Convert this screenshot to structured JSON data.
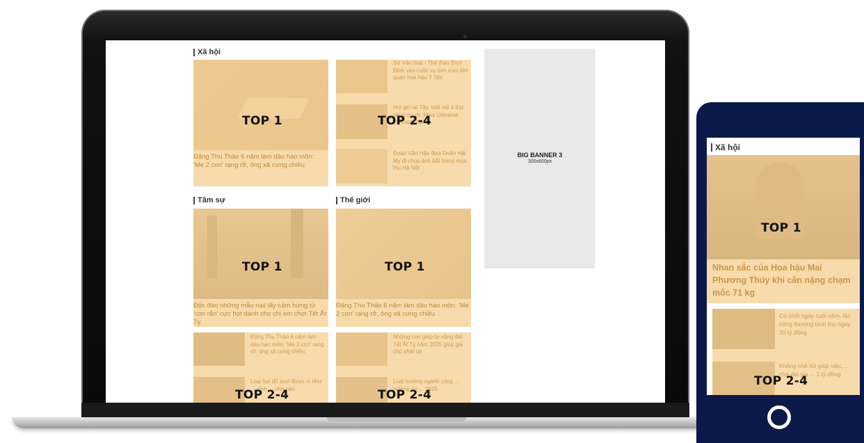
{
  "laptop": {
    "sections": {
      "xa_hoi": {
        "title": "Xã hội",
        "top_label": "TOP 1",
        "top_caption": "Đặng Thu Thảo 6 năm làm dâu hào môn: 'Mẹ 2 con' rạng rỡ, ông xã cưng chiều",
        "side_label": "TOP 2-4",
        "side_items": [
          "Sở Văn hoá - Thể thao Bình Định vào cuộc vụ lùm xùm liên quan hoa hậu Ý Nhi",
          "Hot girl lai Tây, biết nói 4 thứ tiếng dự thi 'Miss Universe Vietnam 2023'",
          "Đoàn Văn Hậu đưa Doãn Hải My đi chụp ảnh bắt trend mùa thu Hà Nội"
        ]
      },
      "tam_su": {
        "title": "Tâm sự",
        "top_label": "TOP 1",
        "top_caption": "Độc đáo những mẫu nail lấy cảm hứng từ 'con rắn' cực hot dành cho chị em chơi Tết Ất Tỵ",
        "side_label": "TOP 2-4",
        "items": [
          "Đặng Thu Thảo 6 năm làm dâu hào môn: 'Mẹ 2 con' rạng rỡ, ông xã cưng chiều",
          "Loại hạt đỏ tươi được ví như ... dinh ... nhà nào"
        ]
      },
      "the_gioi": {
        "title": "Thế giới",
        "top_label": "TOP 1",
        "top_caption": "Đặng Thu Thảo 6 năm làm dâu hào môn: 'Mẹ 2 con' rạng rỡ, ông xã cưng chiều",
        "side_label": "TOP 2-4",
        "items": [
          "Những con giáp tự xông đất Tết Ất Tỵ năm 2025 giúp gia chủ phát tài",
          "Loạt trường ngành công ... hưởng ân ... 2025"
        ]
      }
    },
    "banner": {
      "title": "BIG BANNER 3",
      "size": "300x600px"
    }
  },
  "phone": {
    "section_title": "Xã hội",
    "top_label": "TOP 1",
    "top_caption": "Nhan sắc của Hoa hậu Mai Phương Thúy khi cân nặng chạm mốc 71 kg",
    "side_label": "TOP 2-4",
    "items": [
      "Cú chốt ngày cuối năm, lão nông thương binh thu ngay 20 tỷ đồng",
      "Khống chế nữ giúp việc, ... nhà đại gia ... 1 tỷ đồng"
    ]
  },
  "colors": {
    "overlay": "#f5cd8c",
    "phone_frame": "#0c1a4a",
    "banner_bg": "#e9e9e9"
  }
}
